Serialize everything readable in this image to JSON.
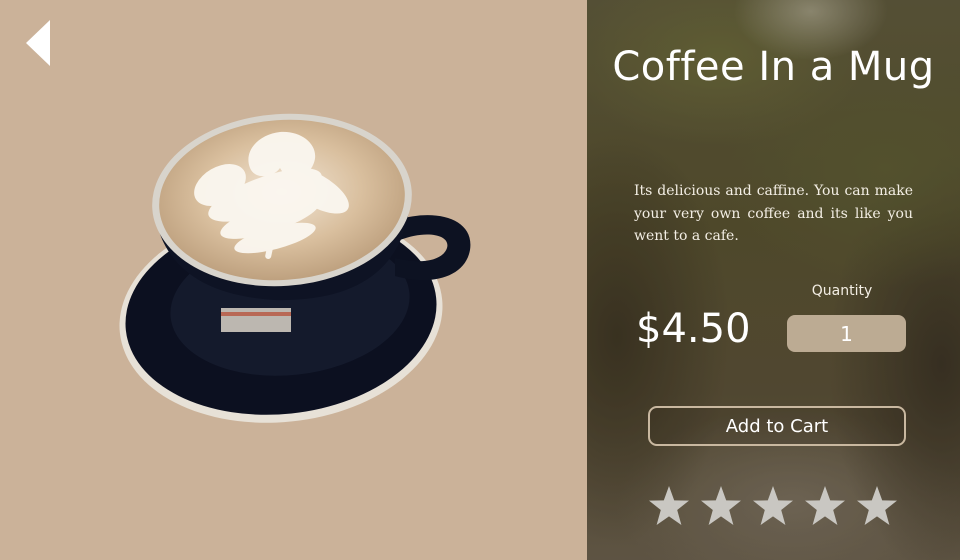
{
  "product": {
    "title": "Coffee In a Mug",
    "description": "Its delicious and caffine. You can make your very own coffee and its like you went to a cafe.",
    "price": "$4.50",
    "quantity_label": "Quantity",
    "quantity_value": "1",
    "add_to_cart_label": "Add to Cart"
  },
  "rating": {
    "max_stars": 5,
    "filled": 0
  },
  "icons": {
    "back": "chevron-left-icon",
    "star": "star-icon"
  },
  "colors": {
    "left_background": "#cbb299",
    "quantity_field": "#bcab93",
    "button_border": "#c9b8a0",
    "star": "#c9c7c2"
  }
}
